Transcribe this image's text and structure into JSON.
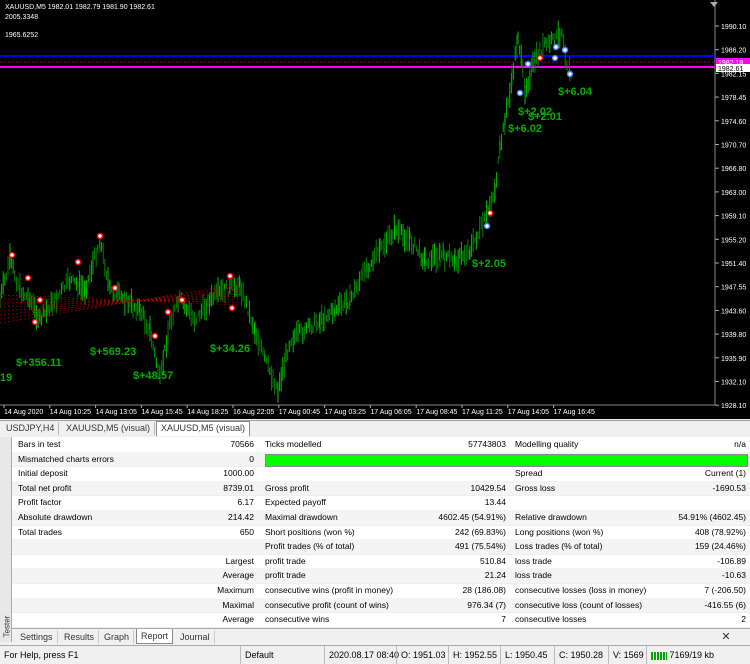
{
  "chart": {
    "symbol_info": "XAUUSD,M5  1982.01 1982.79 1981.90 1982.61",
    "top_labels": [
      "2005.3348",
      "1965.6252"
    ],
    "price_labels": [
      "1990.10",
      "1986.20",
      "1982.15",
      "1978.45",
      "1974.60",
      "1970.70",
      "1966.80",
      "1963.00",
      "1959.10",
      "1955.20",
      "1951.40",
      "1947.55",
      "1943.60",
      "1939.80",
      "1935.90",
      "1932.10",
      "1928.10"
    ],
    "highlight_prices": [
      {
        "label": "1982.18",
        "color": "#ff00ff"
      },
      {
        "label": "1982.61",
        "color": "#ffffff"
      }
    ],
    "time_labels": [
      "14 Aug 2020",
      "14 Aug 10:25",
      "14 Aug 13:05",
      "14 Aug 15:45",
      "14 Aug 18:25",
      "16 Aug 22:05",
      "17 Aug 00:45",
      "17 Aug 03:25",
      "17 Aug 06:05",
      "17 Aug 08:45",
      "17 Aug 11:25",
      "17 Aug 14:05",
      "17 Aug 16:45"
    ],
    "profit_labels": [
      "$+6.04",
      "$+2.02",
      "$+2.01",
      "$+6.02",
      "$+2.05",
      "$+356.11",
      "$+569.23",
      "$+34.26",
      "$+48.57",
      "19"
    ],
    "colors": {
      "line_blue": "#0000ff",
      "line_magenta": "#ff00ff",
      "bull": "#00c000",
      "bear": "#008000",
      "label_green": "#00b000"
    }
  },
  "chart_tabs": [
    "USDJPY,H4",
    "XAUUSD,M5 (visual)",
    "XAUUSD,M5 (visual)"
  ],
  "report": {
    "rows": [
      [
        "Bars in test",
        "70566",
        "Ticks modelled",
        "57743803",
        "Modelling quality",
        "n/a"
      ],
      [
        "Mismatched charts errors",
        "0",
        "",
        "",
        "",
        ""
      ],
      [
        "Initial deposit",
        "1000.00",
        "",
        "",
        "Spread",
        "Current (1)"
      ],
      [
        "Total net profit",
        "8739.01",
        "Gross profit",
        "10429.54",
        "Gross loss",
        "-1690.53"
      ],
      [
        "Profit factor",
        "6.17",
        "Expected payoff",
        "13.44",
        "",
        ""
      ],
      [
        "Absolute drawdown",
        "214.42",
        "Maximal drawdown",
        "4602.45 (54.91%)",
        "Relative drawdown",
        "54.91% (4602.45)"
      ],
      [
        "Total trades",
        "650",
        "Short positions (won %)",
        "242 (69.83%)",
        "Long positions (won %)",
        "408 (78.92%)"
      ],
      [
        "",
        "",
        "Profit trades (% of total)",
        "491 (75.54%)",
        "Loss trades (% of total)",
        "159 (24.46%)"
      ],
      [
        "",
        "Largest",
        "profit trade",
        "510.84",
        "loss trade",
        "-106.89"
      ],
      [
        "",
        "Average",
        "profit trade",
        "21.24",
        "loss trade",
        "-10.63"
      ],
      [
        "",
        "Maximum",
        "consecutive wins (profit in money)",
        "28 (186.08)",
        "consecutive losses (loss in money)",
        "7 (-206.50)"
      ],
      [
        "",
        "Maximal",
        "consecutive profit (count of wins)",
        "976.34 (7)",
        "consecutive loss (count of losses)",
        "-416.55 (6)"
      ],
      [
        "",
        "Average",
        "consecutive wins",
        "7",
        "consecutive losses",
        "2"
      ]
    ]
  },
  "side_label": "Tester",
  "bottom_tabs": [
    "Settings",
    "Results",
    "Graph",
    "Report",
    "Journal"
  ],
  "status": {
    "help": "For Help, press F1",
    "profile": "Default",
    "time": "2020.08.17 08:40",
    "open": "O: 1951.03",
    "high": "H: 1952.55",
    "low": "L: 1950.45",
    "close": "C: 1950.28",
    "volume": "V: 1569",
    "traffic": "7169/19 kb"
  }
}
